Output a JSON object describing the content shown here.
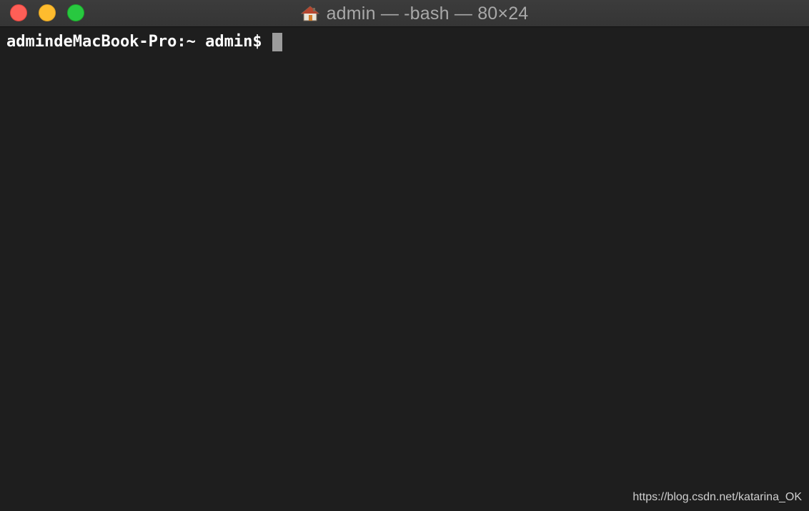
{
  "window": {
    "title": "admin — -bash — 80×24",
    "title_icon": "home-icon",
    "traffic_lights": {
      "close_color": "#fe5f57",
      "minimize_color": "#febc2e",
      "zoom_color": "#28c840"
    }
  },
  "terminal": {
    "prompt": "admindeMacBook-Pro:~ admin$",
    "background_color": "#1e1e1e",
    "text_color": "#ffffff"
  },
  "watermark": {
    "text": "https://blog.csdn.net/katarina_OK"
  }
}
